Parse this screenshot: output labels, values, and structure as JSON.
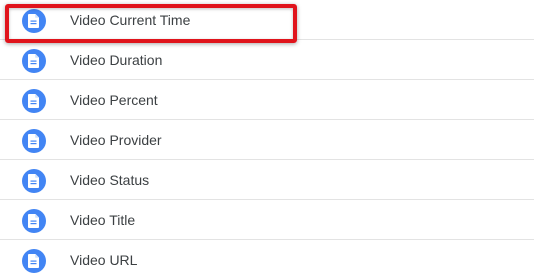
{
  "variables": {
    "items": [
      {
        "label": "Video Current Time",
        "icon": "document-icon"
      },
      {
        "label": "Video Duration",
        "icon": "document-icon"
      },
      {
        "label": "Video Percent",
        "icon": "document-icon"
      },
      {
        "label": "Video Provider",
        "icon": "document-icon"
      },
      {
        "label": "Video Status",
        "icon": "document-icon"
      },
      {
        "label": "Video Title",
        "icon": "document-icon"
      },
      {
        "label": "Video URL",
        "icon": "document-icon"
      }
    ],
    "highlighted_index": 0
  },
  "colors": {
    "icon_background": "#4285f4",
    "text": "#3c4043",
    "divider": "#e3e3e3",
    "highlight": "#e0141c"
  }
}
